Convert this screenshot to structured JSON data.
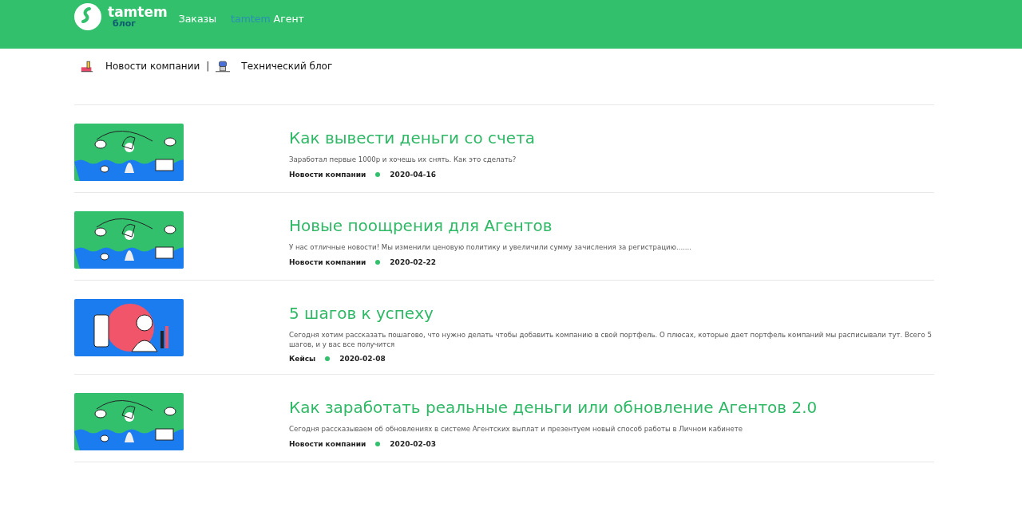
{
  "header": {
    "logo": {
      "name": "tamtem",
      "sub": "блог"
    },
    "nav": [
      {
        "kind": "plain",
        "label": "Заказы"
      },
      {
        "kind": "brand",
        "brand": "tamtem",
        "label": "Агент"
      }
    ]
  },
  "categories": [
    {
      "kind": "factory",
      "label": "Новости компании"
    },
    {
      "kind": "robot",
      "label": "Технический блог"
    }
  ],
  "separator": "|",
  "articles": [
    {
      "kind": "chess",
      "title": "Как вывести деньги со счета",
      "summary": "Заработал первые 1000р и хочешь их снять. Как это сделать?",
      "category": "Новости компании",
      "date": "2020-04-16"
    },
    {
      "kind": "chess",
      "title": "Новые поощрения для Агентов",
      "summary": "У нас отличные новости! Мы изменили ценовую политику и увеличили сумму зачисления за регистрацию.......",
      "category": "Новости компании",
      "date": "2020-02-22"
    },
    {
      "kind": "people",
      "title": "5 шагов к успеху",
      "summary": "Сегодня хотим рассказать пошагово, что нужно делать чтобы добавить компанию в свой портфель. О плюсах, которые дает портфель компаний мы расписывали тут. Всего 5 шагов, и у вас все получится",
      "category": "Кейсы",
      "date": "2020-02-08"
    },
    {
      "kind": "chess",
      "title": "Как заработать реальные деньги или обновление Агентов 2.0",
      "summary": "Сегодня рассказываем об обновлениях в системе Агентских выплат и презентуем новый способ работы в Личном кабинете",
      "category": "Новости компании",
      "date": "2020-02-03"
    }
  ]
}
